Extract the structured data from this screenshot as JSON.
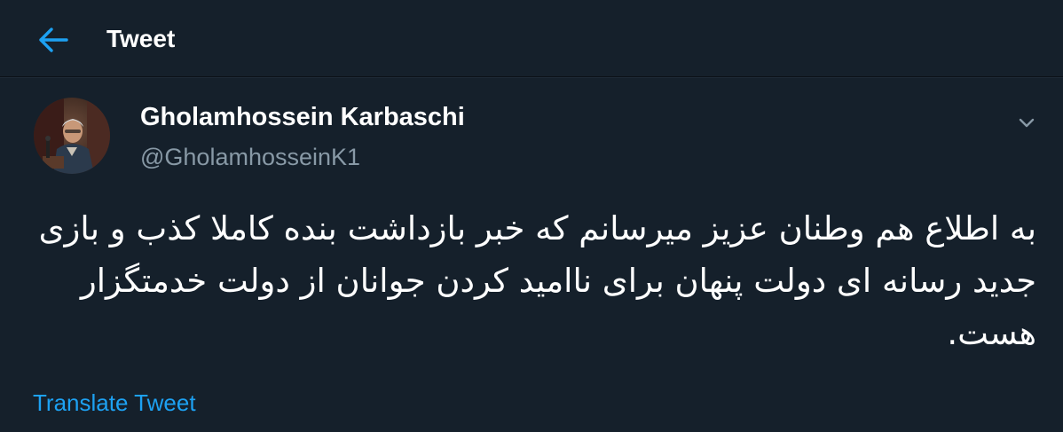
{
  "header": {
    "title": "Tweet",
    "back_icon": "arrow-left-icon",
    "accent_color": "#1da1f2"
  },
  "tweet": {
    "author": {
      "display_name": "Gholamhossein Karbaschi",
      "handle": "@GholamhosseinK1"
    },
    "menu_icon": "chevron-down-icon",
    "text": "به اطلاع هم وطنان عزیز میرسانم که خبر بازداشت بنده کاملا کذب و بازی جدید رسانه ای دولت پنهان برای ناامید کردن جوانان از دولت خدمتگزار هست.",
    "translate_label": "Translate Tweet"
  },
  "colors": {
    "background": "#15202b",
    "secondary_text": "#8899a6",
    "link": "#1da1f2"
  }
}
